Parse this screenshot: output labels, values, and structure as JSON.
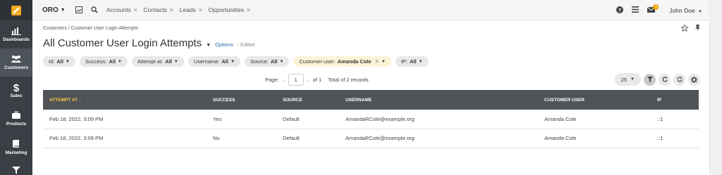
{
  "sidebar": {
    "items": [
      {
        "label": "Dashboards",
        "icon": "bar-chart-icon"
      },
      {
        "label": "Customers",
        "icon": "users-icon",
        "active": true
      },
      {
        "label": "Sales",
        "icon": "dollar-icon"
      },
      {
        "label": "Products",
        "icon": "briefcase-icon"
      },
      {
        "label": "Marketing",
        "icon": "book-icon"
      },
      {
        "label": "",
        "icon": "filter-icon"
      }
    ]
  },
  "topbar": {
    "brand": "ORO",
    "tabs": [
      "Accounts",
      "Contacts",
      "Leads",
      "Opportunities"
    ],
    "notification_count": "1",
    "user": "John Doe"
  },
  "page": {
    "breadcrumb": "Customers / Customer User Login Attempts",
    "title": "All Customer User Login Attempts",
    "options_label": "Options",
    "edited_label": "- Edited"
  },
  "filters": [
    {
      "label": "Id:",
      "value": "All"
    },
    {
      "label": "Success:",
      "value": "All"
    },
    {
      "label": "Attempt at:",
      "value": "All"
    },
    {
      "label": "Username:",
      "value": "All"
    },
    {
      "label": "Source:",
      "value": "All"
    },
    {
      "label": "Customer user:",
      "value": "Amanda Cole"
    },
    {
      "label": "IP:",
      "value": "All"
    }
  ],
  "pager": {
    "page_label": "Page:",
    "page": "1",
    "of_label": "of 1",
    "total_label": "Total of 2 records",
    "per_page": "25"
  },
  "table": {
    "columns": [
      "ATTEMPT AT",
      "SUCCESS",
      "SOURCE",
      "USERNAME",
      "CUSTOMER USER",
      "IP"
    ],
    "sort_marker": "↑",
    "rows": [
      [
        "Feb 18, 2022, 3:09 PM",
        "Yes",
        "Default",
        "AmandaRCole@example.org",
        "Amanda Cole",
        "::1"
      ],
      [
        "Feb 18, 2022, 3:09 PM",
        "No",
        "Default",
        "AmandaRCole@example.org",
        "Amanda Cole",
        "::1"
      ]
    ]
  },
  "colors": {
    "sidebar": "#3a3f45",
    "header": "#505357",
    "accent": "#f3c94a",
    "link": "#2a6eb5"
  }
}
